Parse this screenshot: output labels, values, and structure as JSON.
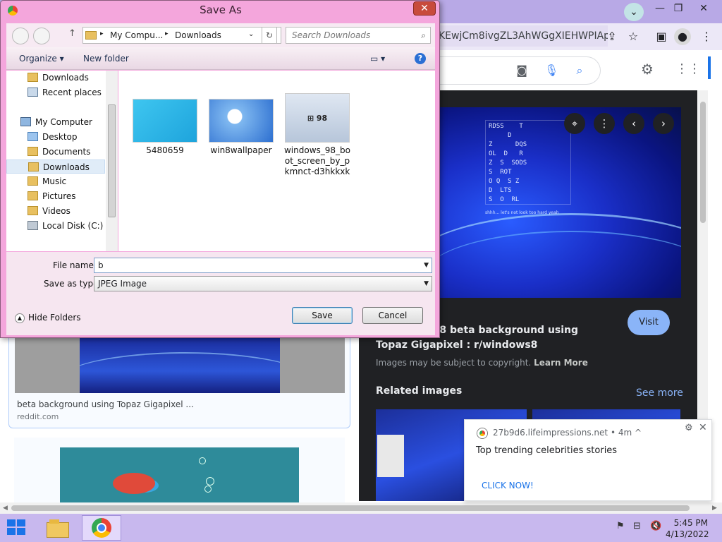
{
  "browser": {
    "omnibox_text": "KEwjCm8ivgZL3AhWGgXIEHWPIAp...",
    "window_controls": [
      "minimize",
      "restore",
      "close"
    ]
  },
  "viewer": {
    "title": "Windows 8 beta background using Topaz Gigapixel : r/windows8",
    "title_visible": "e Windows 8 beta background using",
    "title_line2": "Topaz Gigapixel : r/windows8",
    "visit_label": "Visit",
    "copyright_text": "Images may be subject to copyright.",
    "learn_more": "Learn More",
    "related_heading": "Related images",
    "see_more": "See more",
    "hero_grid_text": "RDSS    T\n     D\nZ      DQS\nOL  D   R\nZ  S  SODS\nS  ROT\nO Q  S Z\nD  LTS\nS  O  RL",
    "hero_caption": "shhh... let's not look too hard yeah"
  },
  "results": {
    "card1_caption": "beta background using Topaz Gigapixel ...",
    "card1_source": "reddit.com"
  },
  "notification": {
    "origin": "27b9d6.lifeimpressions.net",
    "time": "• 4m ^",
    "message": "Top trending celebrities stories",
    "cta": "CLICK NOW!"
  },
  "dialog": {
    "title": "Save As",
    "close": "✕",
    "breadcrumb": [
      "My Compu...",
      "Downloads"
    ],
    "search_placeholder": "Search Downloads",
    "organize": "Organize ▾",
    "new_folder": "New folder",
    "tree_items": [
      {
        "label": "Downloads",
        "icon": "folder"
      },
      {
        "label": "Recent places",
        "icon": "recent"
      },
      {
        "label": "My Computer",
        "icon": "computer"
      },
      {
        "label": "Desktop",
        "icon": "folder"
      },
      {
        "label": "Documents",
        "icon": "folder"
      },
      {
        "label": "Downloads",
        "icon": "folder",
        "selected": true
      },
      {
        "label": "Music",
        "icon": "folder"
      },
      {
        "label": "Pictures",
        "icon": "folder"
      },
      {
        "label": "Videos",
        "icon": "folder"
      },
      {
        "label": "Local Disk (C:)",
        "icon": "disk"
      }
    ],
    "files": [
      {
        "name": "5480659"
      },
      {
        "name": "win8wallpaper"
      },
      {
        "name": "windows_98_boot_screen_by_pkmnct-d3hkkxk"
      }
    ],
    "filename_label": "File name:",
    "filename_value": "b",
    "savetype_label": "Save as type:",
    "savetype_value": "JPEG Image",
    "hide_folders": "Hide Folders",
    "save": "Save",
    "cancel": "Cancel"
  },
  "taskbar": {
    "time": "5:45 PM",
    "date": "4/13/2022"
  },
  "colors": {
    "dialog_frame": "#f4a6dc",
    "taskbar": "#c8b8ee",
    "viewer_bg": "#202124",
    "accent_blue": "#8ab4f8"
  }
}
